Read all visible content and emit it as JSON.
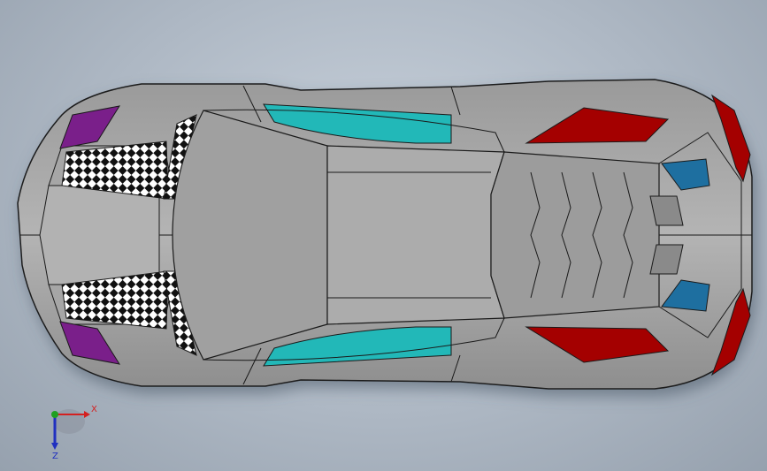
{
  "viewport": {
    "view": "top",
    "colors": {
      "background_center": "#c9d2dc",
      "background_edge": "#96a1ae",
      "body": "#a9a9a9",
      "edge": "#1a1a1a",
      "glass": "#22b8b8",
      "red": "#a40000",
      "purple": "#7a1f8a",
      "blue": "#1e6fa0"
    }
  },
  "triad": {
    "x_label": "X",
    "z_label": "Z",
    "colors": {
      "x": "#d42020",
      "y": "#20a020",
      "z": "#2030c0"
    }
  }
}
